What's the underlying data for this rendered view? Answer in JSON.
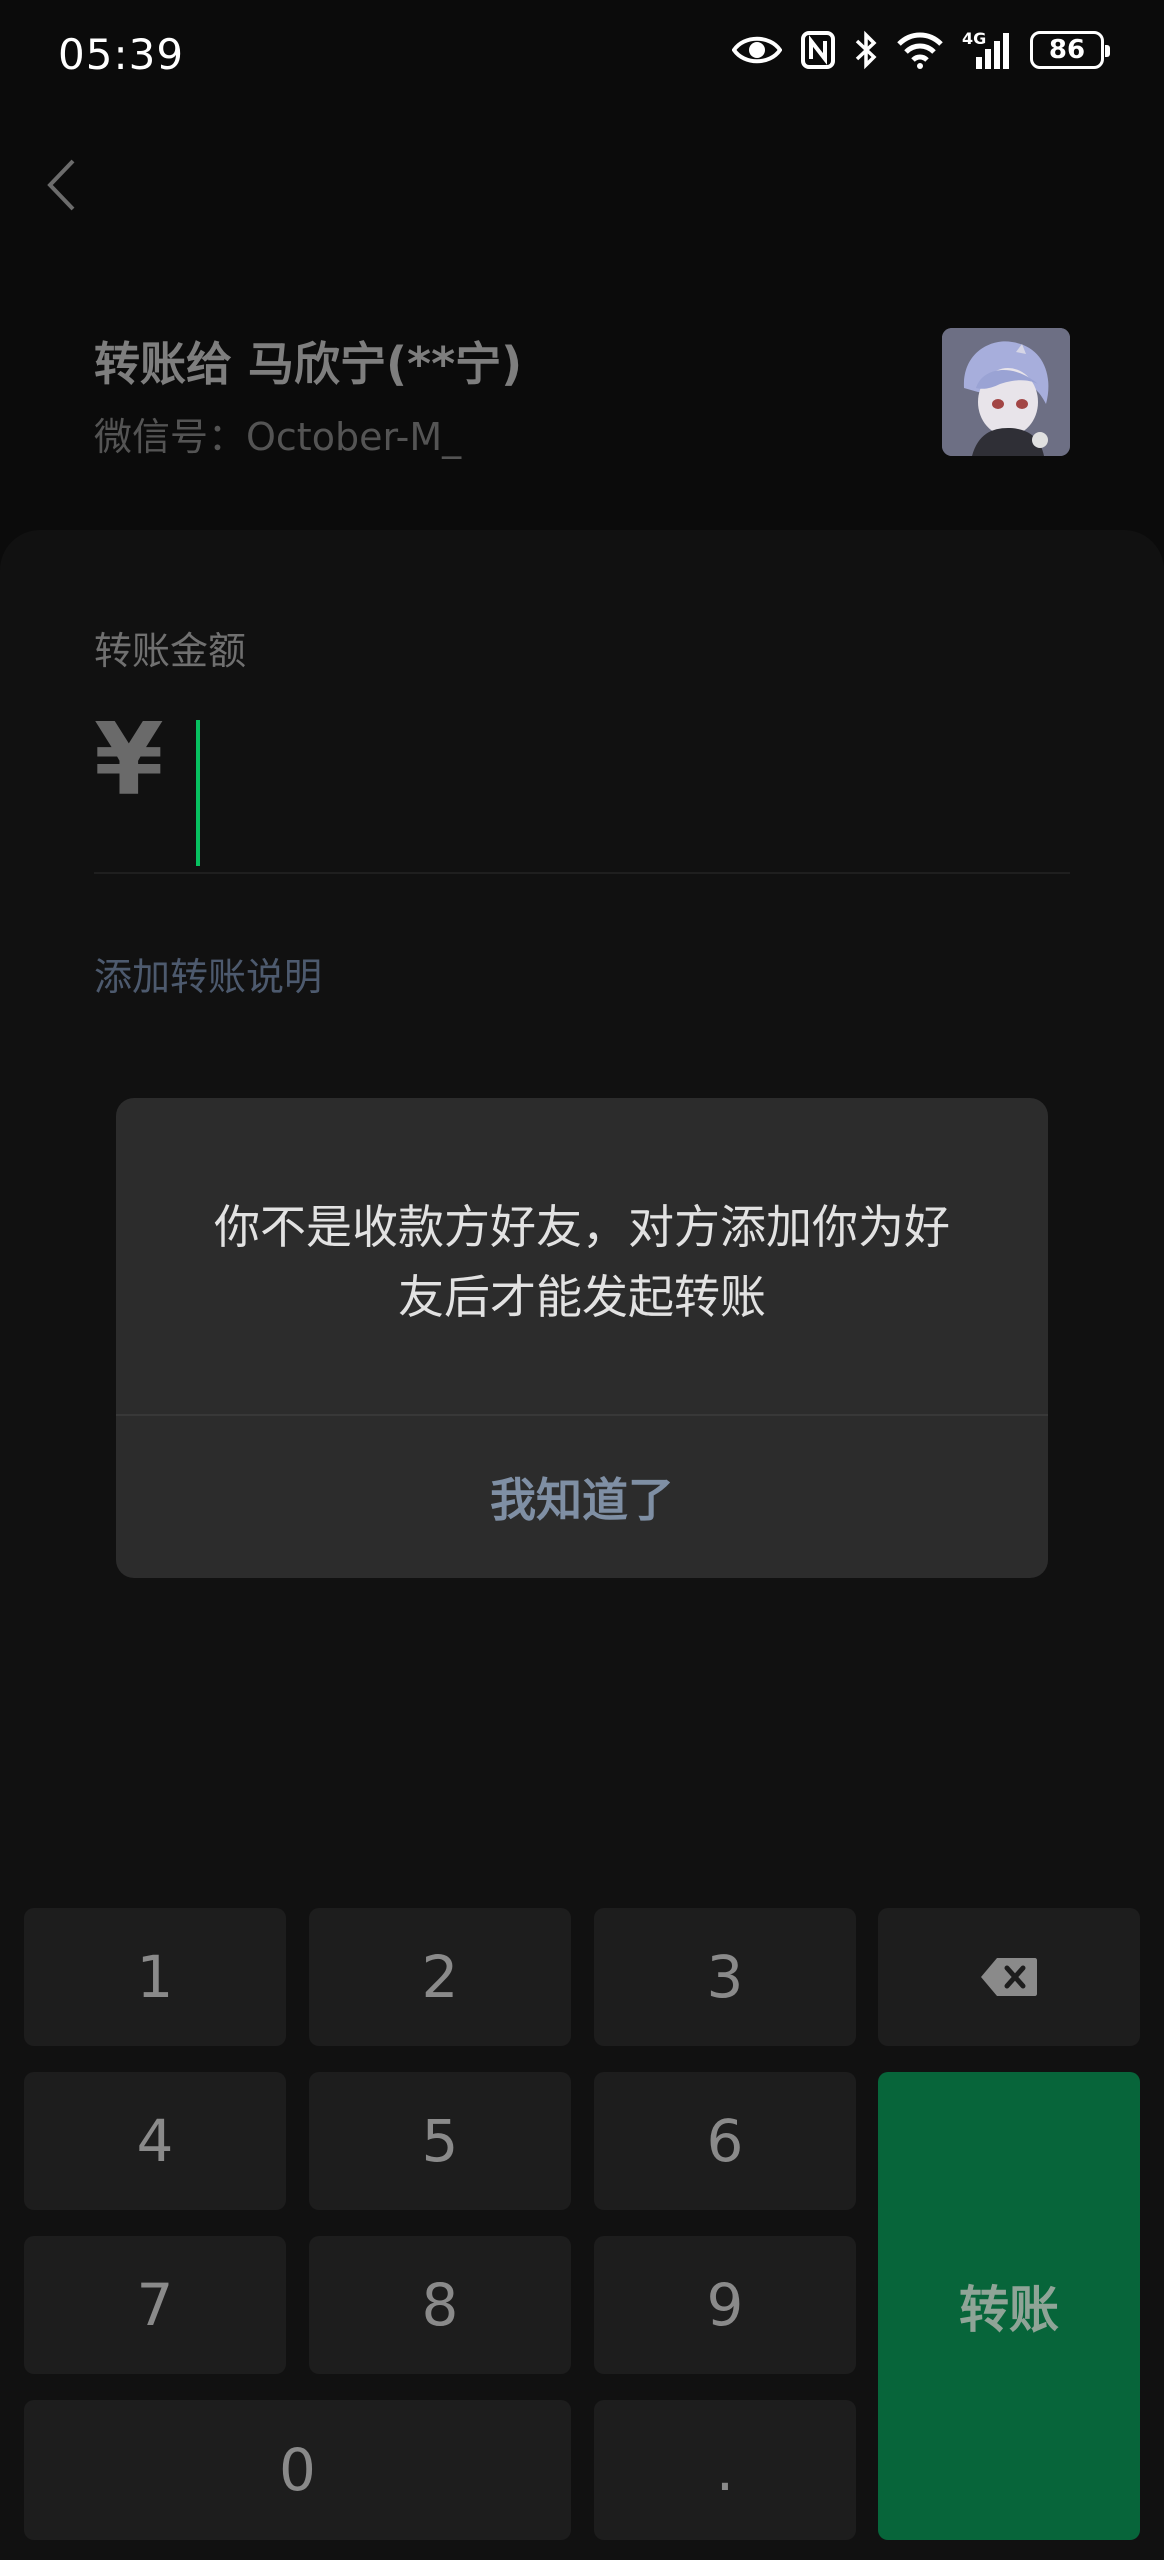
{
  "status_bar": {
    "time": "05:39",
    "network": "4G",
    "battery": "86",
    "icons": [
      "eye-icon",
      "nfc-icon",
      "bluetooth-icon",
      "wifi-icon",
      "signal-icon",
      "battery-icon"
    ]
  },
  "header": {
    "back_icon": "chevron-left-icon",
    "recipient_title": "转账给 马欣宁(**宁)",
    "wechat_id": "微信号：October-M_"
  },
  "amount": {
    "label": "转账金额",
    "currency": "¥",
    "value": "",
    "add_note": "添加转账说明"
  },
  "dialog": {
    "message": "你不是收款方好友，对方添加你为好友后才能发起转账",
    "confirm": "我知道了"
  },
  "keypad": {
    "keys": [
      "1",
      "2",
      "3",
      "4",
      "5",
      "6",
      "7",
      "8",
      "9",
      "0",
      "."
    ],
    "backspace_icon": "backspace-icon",
    "transfer_label": "转账"
  },
  "colors": {
    "accent_green": "#07c160",
    "transfer_button": "#07653a",
    "link": "#4d5a6e"
  }
}
